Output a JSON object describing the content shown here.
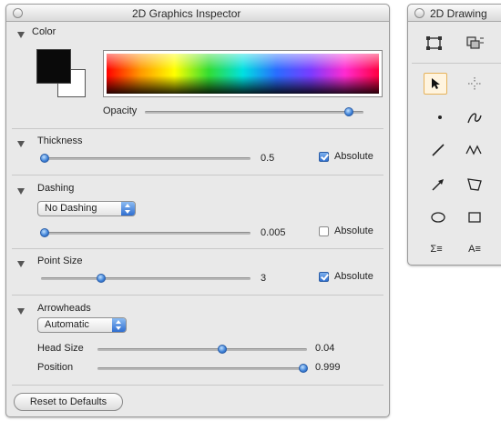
{
  "inspector": {
    "title": "2D Graphics Inspector",
    "color": {
      "label": "Color",
      "fill_color": "#0a0a0a",
      "background_color": "#ffffff",
      "opacity_label": "Opacity",
      "opacity_value": 1.0
    },
    "thickness": {
      "label": "Thickness",
      "value": "0.5",
      "absolute_label": "Absolute",
      "absolute_checked": true
    },
    "dashing": {
      "label": "Dashing",
      "selected": "No Dashing",
      "value": "0.005",
      "absolute_label": "Absolute",
      "absolute_checked": false
    },
    "point_size": {
      "label": "Point Size",
      "value": "3",
      "absolute_label": "Absolute",
      "absolute_checked": true
    },
    "arrowheads": {
      "label": "Arrowheads",
      "selected": "Automatic",
      "head_size_label": "Head Size",
      "head_size_value": "0.04",
      "position_label": "Position",
      "position_value": "0.999"
    },
    "reset_label": "Reset to Defaults"
  },
  "drawing": {
    "title": "2D Drawing",
    "tools": [
      "select-tool-icon",
      "graphics-inset-tool-icon",
      "pointer-tool-icon",
      "coordinate-picker-icon",
      "point-tool-icon",
      "freehand-tool-icon",
      "line-tool-icon",
      "polyline-tool-icon",
      "arrow-tool-icon",
      "polygon-tool-icon",
      "disk-tool-icon",
      "rectangle-tool-icon",
      "math-text-tool-icon",
      "text-tool-icon"
    ],
    "tool_glyph_labels": {
      "math": "Σ≡",
      "text": "A≡"
    },
    "accent": "#2f6fcf",
    "selected_accent": "#e6b25a"
  }
}
